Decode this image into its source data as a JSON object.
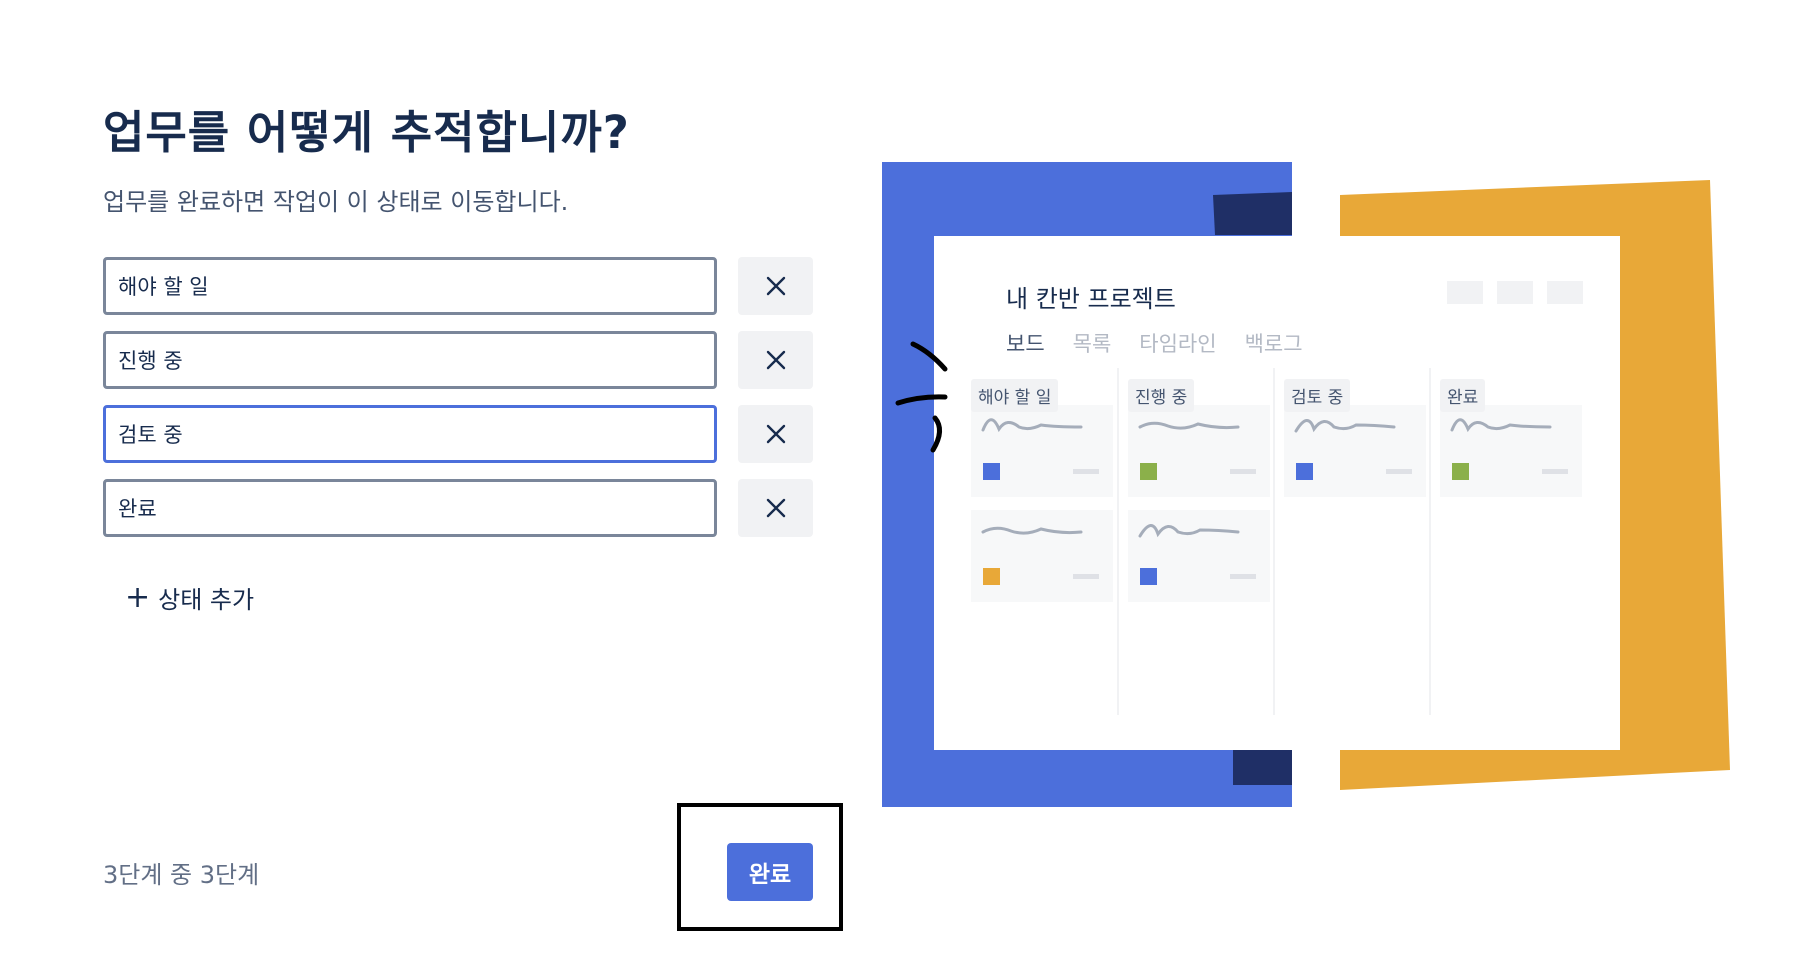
{
  "header": {
    "title": "업무를 어떻게 추적합니까?",
    "subtitle": "업무를 완료하면 작업이 이 상태로 이동합니다."
  },
  "statuses": [
    {
      "value": "해야 할 일",
      "focused": false
    },
    {
      "value": "진행 중",
      "focused": false
    },
    {
      "value": "검토 중",
      "focused": true
    },
    {
      "value": "완료",
      "focused": false
    }
  ],
  "remove_icon": "close-icon",
  "add_status_label": "상태 추가",
  "footer": {
    "step_text": "3단계 중 3단계",
    "done_label": "완료"
  },
  "illustration": {
    "project_title": "내 칸반 프로젝트",
    "tabs": [
      {
        "label": "보드",
        "active": true
      },
      {
        "label": "목록",
        "active": false
      },
      {
        "label": "타임라인",
        "active": false
      },
      {
        "label": "백로그",
        "active": false
      }
    ],
    "columns": [
      {
        "label": "해야 할 일",
        "card_colors": [
          "#4c6fdb",
          "#e8a838"
        ]
      },
      {
        "label": "진행 중",
        "card_colors": [
          "#8bb04a",
          "#4c6fdb"
        ]
      },
      {
        "label": "검토 중",
        "card_colors": [
          "#4c6fdb"
        ]
      },
      {
        "label": "완료",
        "card_colors": [
          "#8bb04a"
        ]
      }
    ]
  },
  "colors": {
    "primary": "#4c6fdb",
    "navy": "#1f2f66",
    "yellow": "#e8a838",
    "green": "#8bb04a",
    "title": "#172b4d"
  }
}
